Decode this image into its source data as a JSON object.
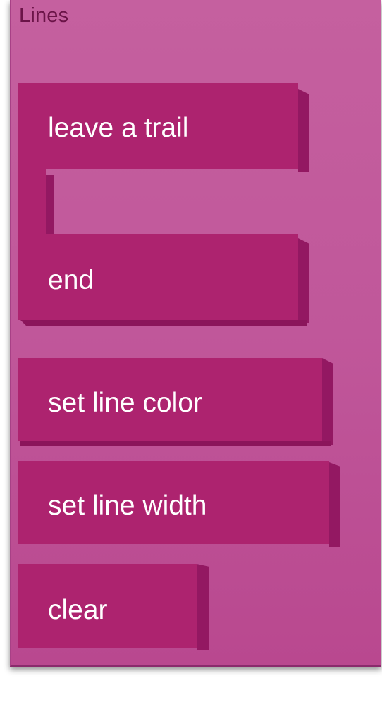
{
  "palette": {
    "title": "Lines",
    "blocks": [
      {
        "id": "leave-trail",
        "label": "leave a trail"
      },
      {
        "id": "end",
        "label": "end"
      },
      {
        "id": "set-line-color",
        "label": "set line color"
      },
      {
        "id": "set-line-width",
        "label": "set line width"
      },
      {
        "id": "clear",
        "label": "clear"
      }
    ]
  },
  "colors": {
    "panel_background": "#c15a9c",
    "block_face": "#ad236f",
    "block_side": "#931862",
    "title_text": "#6b1448",
    "block_text": "#ffffff"
  }
}
